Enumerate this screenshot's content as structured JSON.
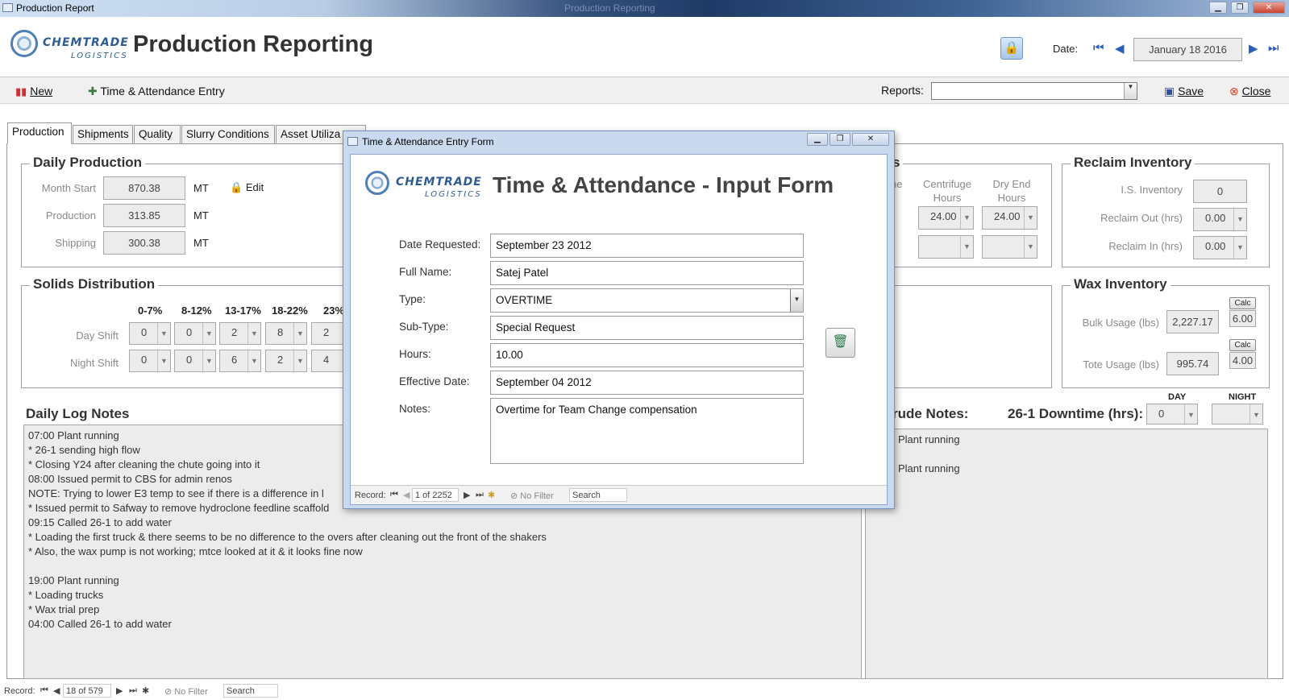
{
  "window": {
    "title": "Production Report",
    "ghost_title": "Production Reporting"
  },
  "brand": {
    "line1": "CHEMTRADE",
    "line2": "LOGISTICS"
  },
  "header": {
    "title": "Production Reporting",
    "date_label": "Date:",
    "date_value": "January 18 2016"
  },
  "toolbar": {
    "new_label": "New",
    "time_label": "Time & Attendance Entry",
    "reports_label": "Reports:",
    "reports_value": "",
    "save_label": "Save",
    "close_label": "Close"
  },
  "tabs": [
    "Production",
    "Shipments",
    "Quality",
    "Slurry Conditions",
    "Asset Utiliza"
  ],
  "daily_production": {
    "title": "Daily Production",
    "edit_label": "Edit",
    "rows": [
      {
        "label": "Month Start",
        "value": "870.38",
        "unit": "MT"
      },
      {
        "label": "Production",
        "value": "313.85",
        "unit": "MT"
      },
      {
        "label": "Shipping",
        "value": "300.38",
        "unit": "MT"
      }
    ]
  },
  "solids": {
    "title": "Solids Distribution",
    "headers": [
      "0-7%",
      "8-12%",
      "13-17%",
      "18-22%",
      "23%"
    ],
    "day_label": "Day Shift",
    "night_label": "Night Shift",
    "day": [
      "0",
      "0",
      "2",
      "8",
      "2"
    ],
    "night": [
      "0",
      "0",
      "6",
      "2",
      "4"
    ]
  },
  "hours_group": {
    "title_fragment": "s",
    "col0": "ne",
    "col1a": "Centrifuge",
    "col1b": "Hours",
    "col2a": "Dry End",
    "col2b": "Hours",
    "row1": [
      "24.00",
      "24.00"
    ]
  },
  "reclaim": {
    "title": "Reclaim Inventory",
    "rows": [
      {
        "label": "I.S. Inventory",
        "value": "0"
      },
      {
        "label": "Reclaim Out (hrs)",
        "value": "0.00"
      },
      {
        "label": "Reclaim In (hrs)",
        "value": "0.00"
      }
    ]
  },
  "wax": {
    "title": "Wax Inventory",
    "calc": "Calc",
    "rows": [
      {
        "label": "Bulk Usage (lbs)",
        "value": "2,227.17",
        "extra": "6.00"
      },
      {
        "label": "Tote Usage (lbs)",
        "value": "995.74",
        "extra": "4.00"
      }
    ]
  },
  "log": {
    "title": "Daily Log Notes",
    "text": "07:00 Plant running\n* 26-1 sending high flow\n* Closing Y24 after cleaning the chute going into it\n08:00 Issued permit to CBS for admin renos\nNOTE: Trying to lower E3 temp to see if there is a difference in l\n* Issued permit to Safway to remove hydroclone feedline scaffold\n09:15 Called 26-1 to add water\n* Loading the first truck & there seems to be no difference to the overs after cleaning out the front of the shakers\n* Also, the wax pump is not working; mtce looked at it & it looks fine now\n\n19:00 Plant running\n* Loading trucks\n* Wax trial prep\n04:00 Called 26-1 to add water"
  },
  "crude": {
    "title": "rude Notes:",
    "downtime_label": "26-1 Downtime (hrs):",
    "day_label": "DAY",
    "night_label": "NIGHT",
    "day_value": "0",
    "night_value": "",
    "text": "Plant running\n\nPlant running"
  },
  "status": {
    "record_label": "Record:",
    "position": "18 of 579",
    "filter": "No Filter",
    "search": "Search"
  },
  "modal": {
    "title": "Time & Attendance Entry Form",
    "heading": "Time & Attendance - Input Form",
    "fields": [
      {
        "label": "Date Requested:",
        "value": "September 23 2012"
      },
      {
        "label": "Full Name:",
        "value": "Satej Patel"
      },
      {
        "label": "Type:",
        "value": "OVERTIME"
      },
      {
        "label": "Sub-Type:",
        "value": "Special Request"
      },
      {
        "label": "Hours:",
        "value": "10.00"
      },
      {
        "label": "Effective Date:",
        "value": "September 04 2012"
      },
      {
        "label": "Notes:",
        "value": "Overtime for Team Change compensation"
      }
    ],
    "status": {
      "record_label": "Record:",
      "position": "1 of 2252",
      "filter": "No Filter",
      "search": "Search"
    }
  }
}
